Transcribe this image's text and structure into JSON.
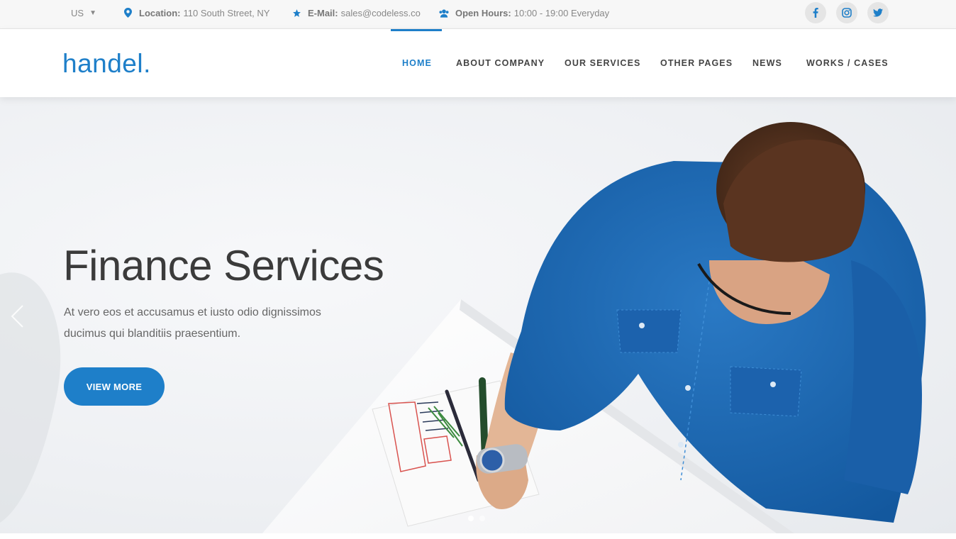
{
  "topbar": {
    "language": "US",
    "location_label": "Location:",
    "location_value": "110 South Street, NY",
    "email_label": "E-Mail:",
    "email_value": "sales@codeless.co",
    "hours_label": "Open Hours:",
    "hours_value": "10:00 - 19:00 Everyday",
    "icons": [
      "map-pin-icon",
      "star-icon",
      "people-icon"
    ],
    "social": [
      "facebook-icon",
      "instagram-icon",
      "twitter-icon"
    ]
  },
  "header": {
    "logo": "handel.",
    "nav": [
      {
        "label": "HOME",
        "active": true
      },
      {
        "label": "ABOUT COMPANY"
      },
      {
        "label": "OUR SERVICES"
      },
      {
        "label": "OTHER PAGES"
      },
      {
        "label": "NEWS"
      },
      {
        "label": "WORKS / CASES"
      }
    ]
  },
  "hero": {
    "title": "Finance Services",
    "text": "At vero eos et accusamus et iusto odio dignissimos ducimus qui blanditiis praesentium.",
    "button": "VIEW MORE",
    "slides": 2,
    "active_slide": 1
  },
  "colors": {
    "accent": "#1e7fc9",
    "topbar_bg": "#f7f7f7",
    "text_dark": "#3b3b3b"
  }
}
